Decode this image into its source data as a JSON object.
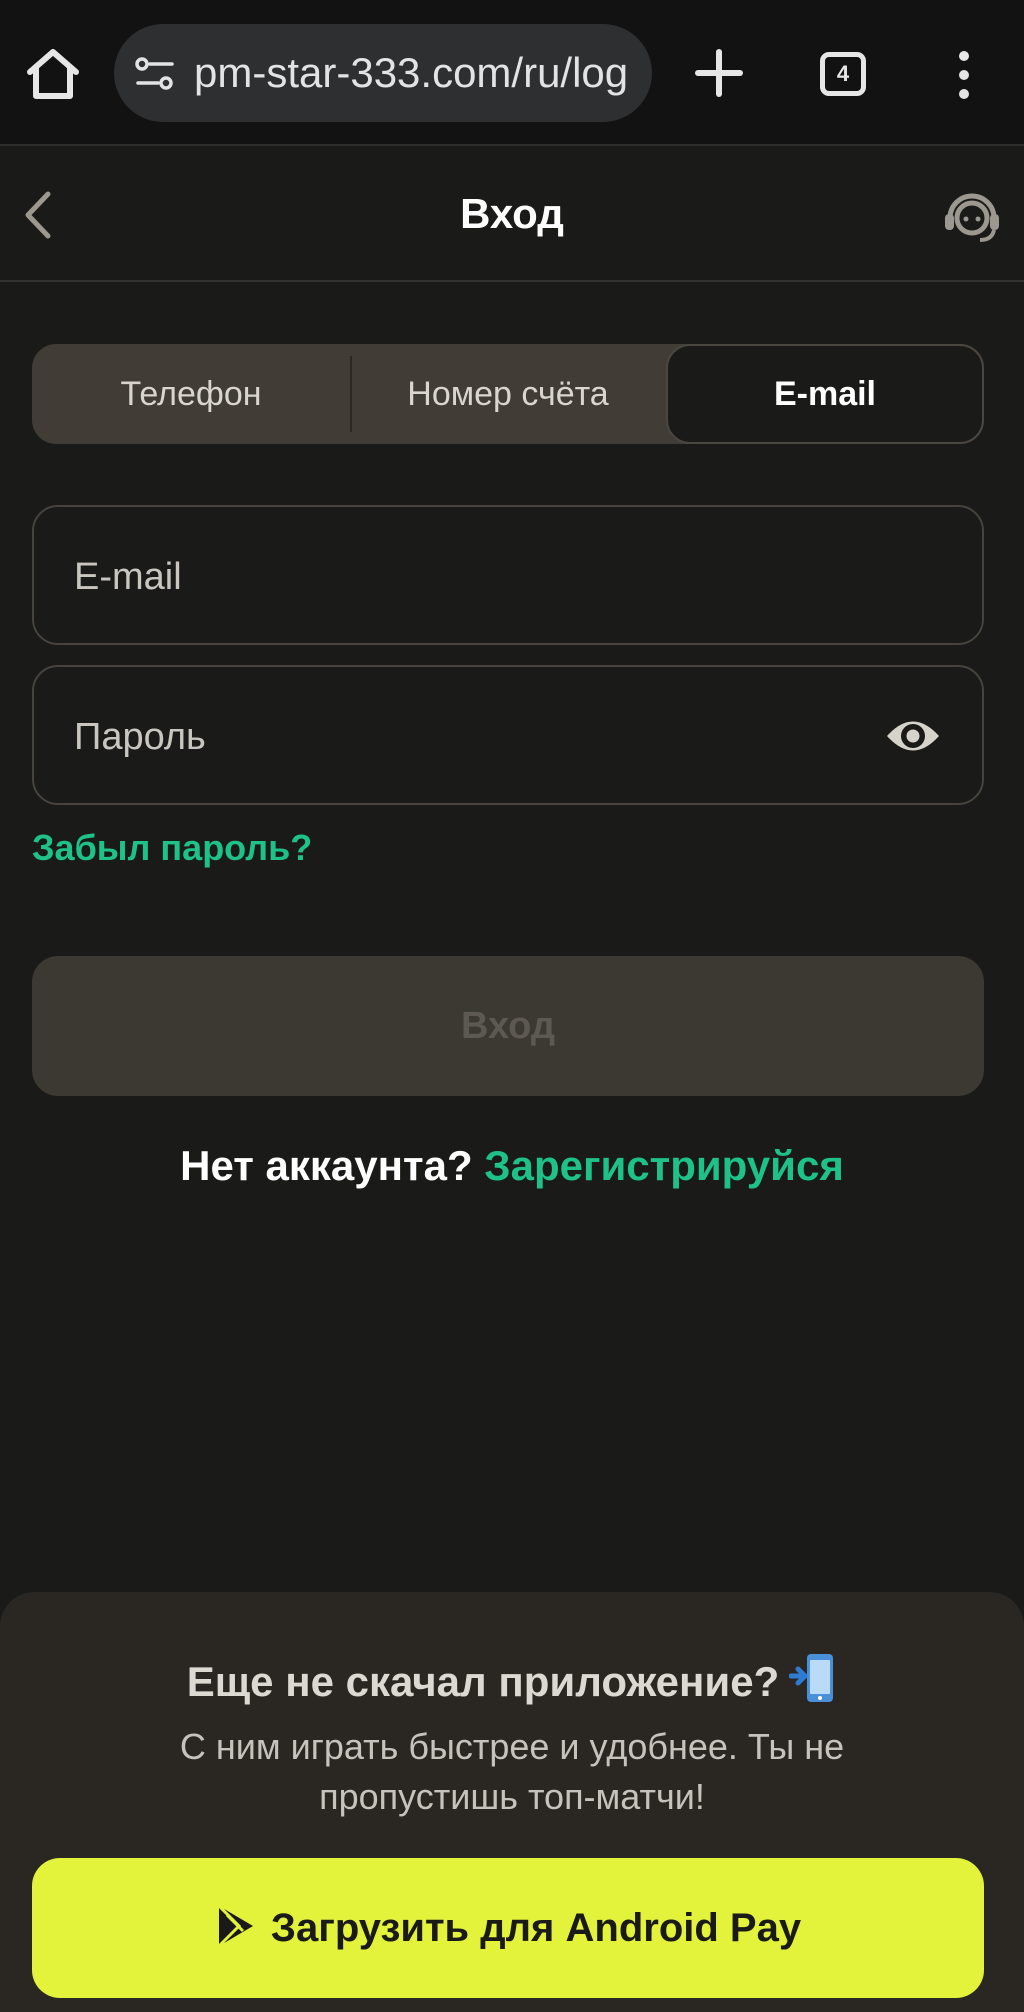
{
  "browser": {
    "url": "pm-star-333.com/ru/log",
    "tab_count": "4",
    "icons": [
      "home-icon",
      "site-settings-icon",
      "new-tab-icon",
      "tabs-icon",
      "more-menu-icon"
    ]
  },
  "header": {
    "title": "Вход"
  },
  "tabs": [
    {
      "label": "Телефон",
      "active": false
    },
    {
      "label": "Номер счёта",
      "active": false
    },
    {
      "label": "E-mail",
      "active": true
    }
  ],
  "form": {
    "email_placeholder": "E-mail",
    "password_placeholder": "Пароль",
    "forgot_label": "Забыл пароль?",
    "submit_label": "Вход",
    "no_account": "Нет аккаунта?",
    "register_label": "Зарегистрируйся"
  },
  "promo": {
    "title": "Еще не скачал приложение?",
    "description": "С ним играть быстрее и удобнее. Ты не пропустишь  топ-матчи!",
    "download_label": "Загрузить для Android Pay"
  },
  "colors": {
    "accent_green": "#1ec289",
    "cta_yellow": "#e3f23b",
    "background": "#1a1a18"
  }
}
